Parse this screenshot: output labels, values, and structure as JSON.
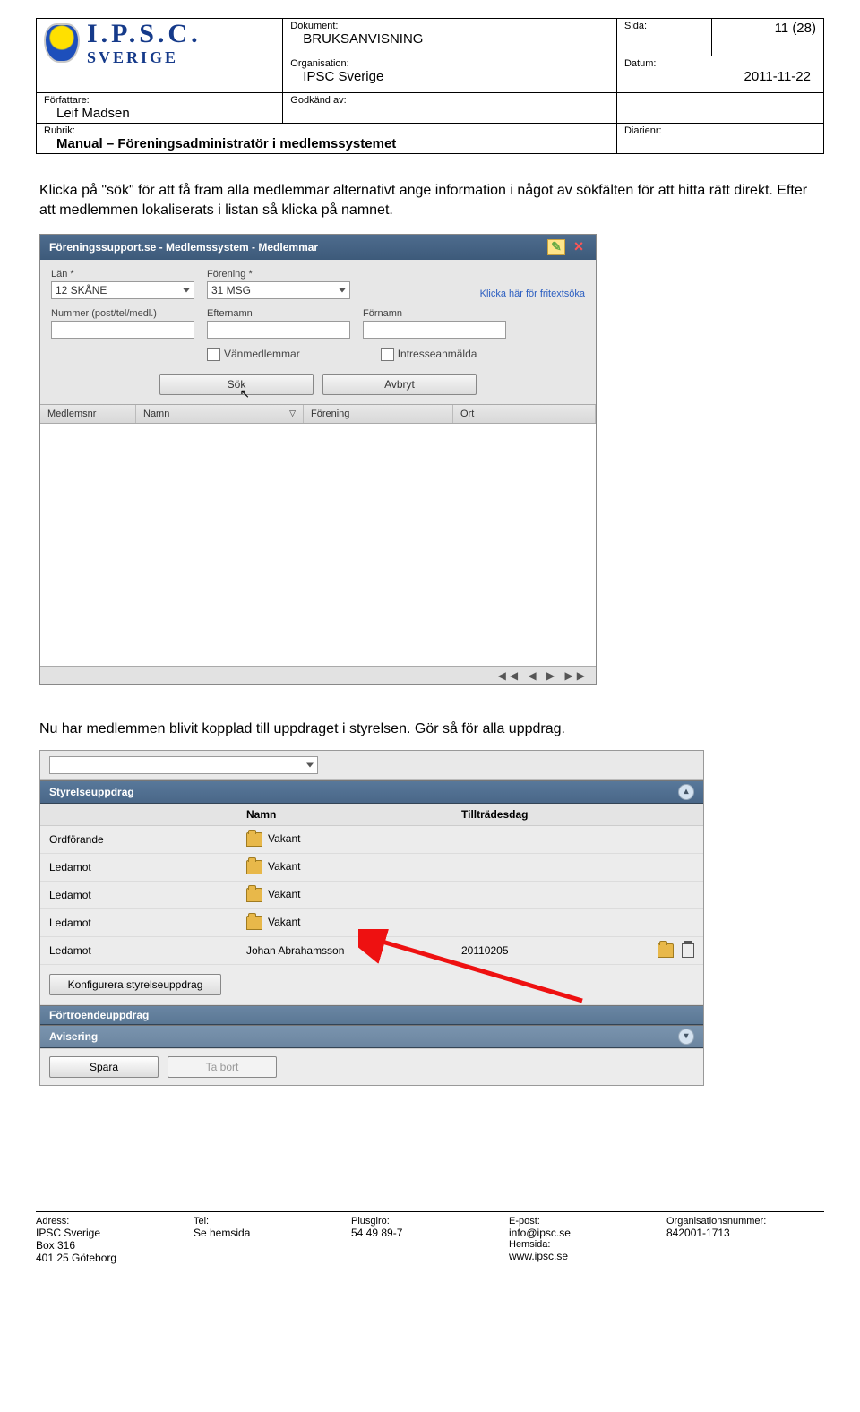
{
  "header": {
    "dokument_label": "Dokument:",
    "dokument_value": "BRUKSANVISNING",
    "sida_label": "Sida:",
    "sida_value": "11 (28)",
    "org_label": "Organisation:",
    "org_value": "IPSC Sverige",
    "datum_label": "Datum:",
    "datum_value": "2011-11-22",
    "forf_label": "Författare:",
    "forf_value": "Leif Madsen",
    "godk_label": "Godkänd av:",
    "rubrik_label": "Rubrik:",
    "rubrik_value": "Manual – Föreningsadministratör i medlemssystemet",
    "diarie_label": "Diarienr:",
    "logo_l1": "I.P.S.C.",
    "logo_l2": "SVERIGE"
  },
  "para1": "Klicka på \"sök\" för att få fram alla medlemmar alternativt ange information i något av sökfälten för att hitta rätt direkt. Efter att medlemmen lokaliserats i listan så klicka på namnet.",
  "dialog1": {
    "title": "Föreningssupport.se - Medlemssystem - Medlemmar",
    "freetext_link": "Klicka här för fritextsöka",
    "lan_label": "Län *",
    "lan_value": "12 SKÅNE",
    "forening_label": "Förening *",
    "forening_value": "31 MSG",
    "num_label": "Nummer (post/tel/medl.)",
    "eft_label": "Efternamn",
    "for_label": "Förnamn",
    "chk1": "Vänmedlemmar",
    "chk2": "Intresseanmälda",
    "btn_sok": "Sök",
    "btn_avbryt": "Avbryt",
    "col1": "Medlemsnr",
    "col2": "Namn",
    "col3": "Förening",
    "col4": "Ort",
    "pager": "◀◀ ◀ ▶ ▶▶"
  },
  "para2": "Nu har medlemmen blivit kopplad till uppdraget i styrelsen. Gör så för alla uppdrag.",
  "panel2": {
    "sec1": "Styrelseuppdrag",
    "th_namn": "Namn",
    "th_dag": "Tillträdesdag",
    "rows": [
      {
        "role": "Ordförande",
        "name": "Vakant",
        "date": ""
      },
      {
        "role": "Ledamot",
        "name": "Vakant",
        "date": ""
      },
      {
        "role": "Ledamot",
        "name": "Vakant",
        "date": ""
      },
      {
        "role": "Ledamot",
        "name": "Vakant",
        "date": ""
      },
      {
        "role": "Ledamot",
        "name": "Johan Abrahamsson",
        "date": "20110205"
      }
    ],
    "btn_cfg": "Konfigurera styrelseuppdrag",
    "sec2": "Förtroendeuppdrag",
    "sec3": "Avisering",
    "btn_save": "Spara",
    "btn_del": "Ta bort"
  },
  "footer": {
    "c1_l": "Adress:",
    "c1_1": "IPSC Sverige",
    "c1_2": "Box 316",
    "c1_3": "401 25 Göteborg",
    "c2_l": "Tel:",
    "c2_1": "Se hemsida",
    "c3_l": "Plusgiro:",
    "c3_1": "54 49 89-7",
    "c4_l": "E-post:",
    "c4_1": "info@ipsc.se",
    "c4_l2": "Hemsida:",
    "c4_2": "www.ipsc.se",
    "c5_l": "Organisationsnummer:",
    "c5_1": "842001-1713"
  }
}
